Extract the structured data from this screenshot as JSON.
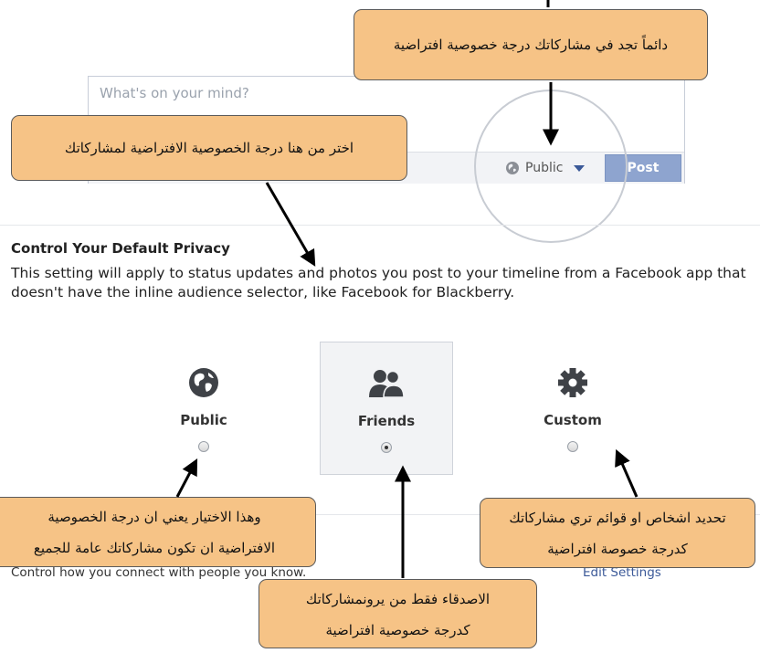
{
  "composer": {
    "placeholder": "What's on your mind?",
    "audience_label": "Public",
    "post_label": "Post"
  },
  "section": {
    "title": "Control Your Default Privacy",
    "description": "This setting will apply to status updates and photos you post to your timeline from a Facebook app that doesn't have the inline audience selector, like Facebook for Blackberry."
  },
  "options": [
    {
      "label": "Public",
      "icon": "globe-icon",
      "selected": false
    },
    {
      "label": "Friends",
      "icon": "friends-icon",
      "selected": true
    },
    {
      "label": "Custom",
      "icon": "gear-icon",
      "selected": false
    }
  ],
  "connect": {
    "text": "Control how you connect with people you know.",
    "edit_link": "Edit Settings"
  },
  "callouts": {
    "top_right": "دائماً تجد في مشاركاتك درجة خصوصية افتراضية",
    "top_left": "اختر من هنا درجة الخصوصية الافتراضية لمشاركاتك",
    "public_line1": "وهذا الاختيار يعني ان درجة الخصوصية",
    "public_line2": "الافتراضية ان تكون مشاركاتك عامة للجميع",
    "custom_line1": "تحديد اشخاص او قوائم تري مشاركاتك",
    "custom_line2": "كدرجة خصوصة افتراضية",
    "friends_line1": "الاصدقاء فقط من يرونمشاركاتك",
    "friends_line2": "كدرجة خصوصية افتراضية"
  },
  "colors": {
    "callout_fill": "#f6c386",
    "link": "#3b5998",
    "post_button": "#8ea4cf"
  }
}
